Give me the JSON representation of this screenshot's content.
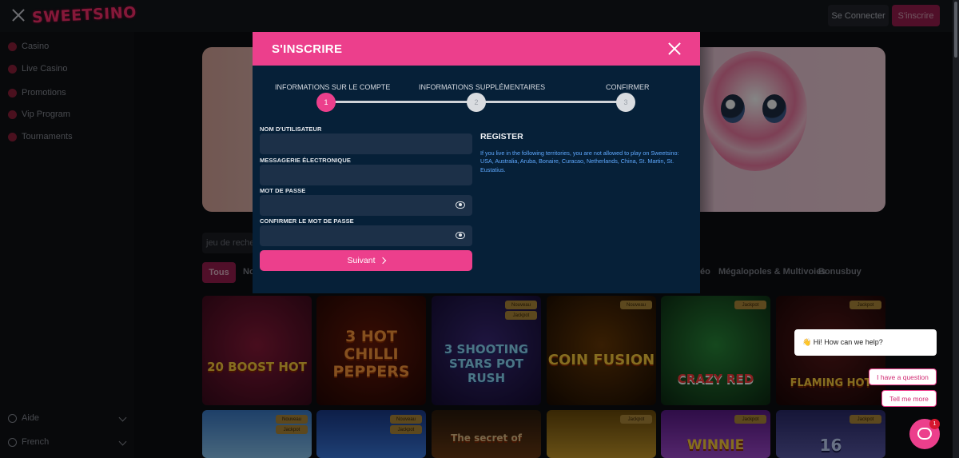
{
  "topbar": {
    "logo_text": "SWEETSINO",
    "login_label": "Se Connecter",
    "register_label": "S'inscrire"
  },
  "sidebar": {
    "items": [
      {
        "label": "Casino",
        "icon": "casino-icon"
      },
      {
        "label": "Live Casino",
        "icon": "live-casino-icon"
      },
      {
        "label": "Promotions",
        "icon": "promotions-icon"
      },
      {
        "label": "Vip Program",
        "icon": "vip-icon"
      },
      {
        "label": "Tournaments",
        "icon": "tournaments-icon"
      }
    ],
    "bottom": [
      {
        "label": "Aide",
        "icon": "help-icon"
      },
      {
        "label": "French",
        "icon": "globe-icon"
      }
    ]
  },
  "main": {
    "search_placeholder": "jeu de recherche",
    "tabs": {
      "all": "Tous",
      "partial_left": "No",
      "partial_right": "éo",
      "megapoles": "Mégalopoles & Multivoies",
      "bonusbuy": "Bonusbuy"
    },
    "games": [
      {
        "title": "20 BOOST HOT",
        "badges": []
      },
      {
        "title": "3 HOT CHILLI PEPPERS",
        "badges": []
      },
      {
        "title": "3 SHOOTING STARS POT RUSH",
        "badges": [
          "Nouveau",
          "Jackpot"
        ]
      },
      {
        "title": "COIN FUSION",
        "badges": [
          "Nouveau"
        ]
      },
      {
        "title": "CRAZY RED",
        "badges": [
          "Jackpot"
        ]
      },
      {
        "title": "FLAMING HOT",
        "badges": [
          "Jackpot"
        ]
      },
      {
        "title": "",
        "badges": [
          "Nouveau",
          "Jackpot"
        ]
      },
      {
        "title": "",
        "badges": [
          "Nouveau",
          "Jackpot"
        ]
      },
      {
        "title": "The secret of",
        "badges": []
      },
      {
        "title": "",
        "badges": [
          "Jackpot"
        ]
      },
      {
        "title": "WINNIE",
        "badges": [
          "Jackpot"
        ]
      },
      {
        "title": "16",
        "badges": [
          "Jackpot"
        ]
      }
    ]
  },
  "modal": {
    "title": "S'INSCRIRE",
    "steps": [
      {
        "label": "INFORMATIONS SUR LE COMPTE",
        "number": "1"
      },
      {
        "label": "INFORMATIONS SUPPLÉMENTAIRES",
        "number": "2"
      },
      {
        "label": "CONFIRMER",
        "number": "3"
      }
    ],
    "fields": {
      "username_label": "NOM D'UTILISATEUR",
      "email_label": "MESSAGERIE ÉLECTRONIQUE",
      "password_label": "MOT DE PASSE",
      "confirm_password_label": "CONFIRMER LE MOT DE PASSE"
    },
    "next_label": "Suivant",
    "register_title": "REGISTER",
    "register_notice": "If you live in the following territories, you are not allowed to play on Sweetsino: USA, Australia, Aruba, Bonaire, Curacao, Netherlands, China, St. Martin, St. Eustatius."
  },
  "chat": {
    "greeting": "👋 Hi! How can we help?",
    "question_label": "I have a question",
    "more_label": "Tell me more",
    "unread_count": "1"
  },
  "colors": {
    "accent": "#ec3f8c",
    "modal_bg": "#062038",
    "notice_text": "#5fa9ff"
  }
}
